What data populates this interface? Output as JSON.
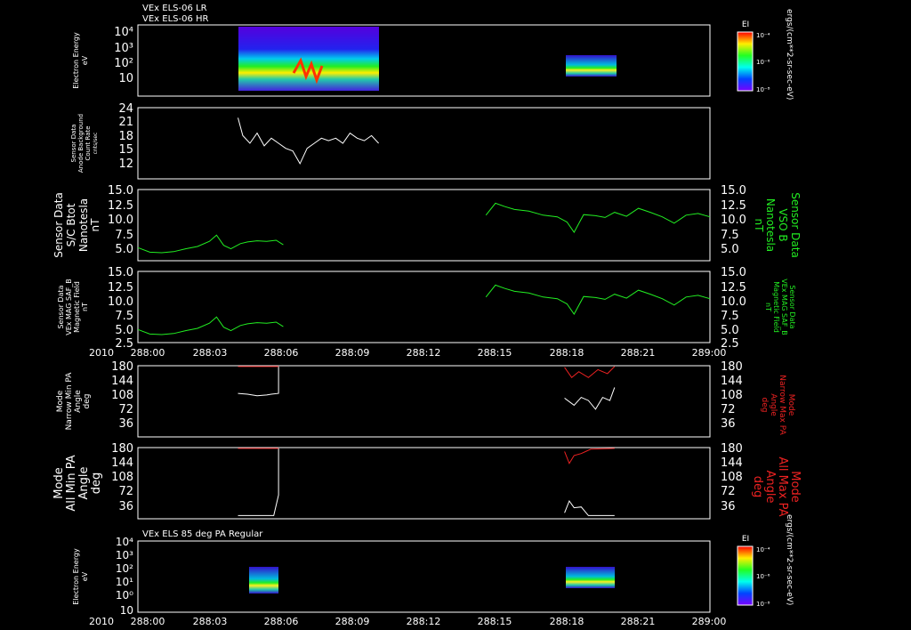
{
  "colors": {
    "background": "#000000",
    "axis": "#ffffff",
    "green": "#22ee22",
    "red": "#ee2222",
    "white": "#ffffff"
  },
  "header": {
    "line1": "VEx ELS-06 LR",
    "line2": "VEx ELS-06 HR",
    "bottom_title": "VEx ELS 85 deg PA Regular"
  },
  "colorbar": {
    "label": "EI",
    "tick_hi": "10⁻⁴",
    "tick_mid": "10⁻⁶",
    "tick_lo": "10⁻⁸",
    "unit": "ergs/(cm**2-sr-sec-eV)"
  },
  "xaxis": {
    "year": "2010",
    "ticks": [
      "288:00",
      "288:03",
      "288:06",
      "288:09",
      "288:12",
      "288:15",
      "288:18",
      "288:21",
      "289:00"
    ]
  },
  "panels": {
    "p1": {
      "ylabel": [
        "Electron Energy",
        "eV"
      ],
      "ticks": [
        "10⁴",
        "10³",
        "10²",
        "10"
      ]
    },
    "p2": {
      "ylabel": [
        "Sensor Data",
        "Anode Background",
        "Count Rate",
        "cnts/sec"
      ],
      "ticks": [
        "24",
        "21",
        "18",
        "15",
        "12"
      ]
    },
    "p3": {
      "ylabel": [
        "Sensor Data",
        "S/C Btot",
        "Nanotesla",
        "nT"
      ],
      "ylabel_right": [
        "Sensor Data",
        "VSO B",
        "Nanotesla",
        "nT"
      ],
      "ticks": [
        "15.0",
        "12.5",
        "10.0",
        "7.5",
        "5.0"
      ]
    },
    "p4": {
      "ylabel": [
        "Sensor Data",
        "VEx MAG SAF_B",
        "Magnetic Field",
        "nT"
      ],
      "ylabel_right": [
        "Sensor Data",
        "VEx MAG SAF_B",
        "Magnetic Field",
        "nT"
      ],
      "ticks": [
        "15.0",
        "12.5",
        "10.0",
        "7.5",
        "5.0",
        "2.5"
      ]
    },
    "p5": {
      "ylabel": [
        "Mode",
        "Narrow Min PA",
        "Angle",
        "deg"
      ],
      "ylabel_right": [
        "Mode",
        "Narrow Max PA",
        "Angle",
        "deg"
      ],
      "ticks": [
        "180",
        "144",
        "108",
        "72",
        "36"
      ]
    },
    "p6": {
      "ylabel": [
        "Mode",
        "All Min PA",
        "Angle",
        "deg"
      ],
      "ylabel_right": [
        "Mode",
        "All Max PA",
        "Angle",
        "deg"
      ],
      "ticks": [
        "180",
        "144",
        "108",
        "72",
        "36"
      ]
    },
    "p7": {
      "ylabel": [
        "Electron Energy",
        "eV"
      ],
      "ticks": [
        "10⁴",
        "10³",
        "10²",
        "10¹",
        "10⁰",
        "10"
      ]
    }
  },
  "chart_data": [
    {
      "type": "heatmap",
      "title": "VEx ELS-06 LR / HR",
      "ylabel": "Electron Energy eV",
      "ylog": true,
      "ylim": [
        5,
        15000
      ],
      "xlim": [
        "288:00",
        "289:00"
      ],
      "blocks": [
        {
          "x_start": "288:04.1",
          "x_end": "288:10.4"
        },
        {
          "x_start": "288:17.9",
          "x_end": "288:20.0"
        }
      ]
    },
    {
      "type": "line",
      "ylabel": "Anode Background Count Rate cnts/sec",
      "ylim": [
        10,
        24
      ],
      "series": [
        {
          "x": [
            4.2,
            4.4,
            4.7,
            5.0,
            5.3,
            5.6,
            5.9,
            6.2,
            6.5,
            6.8,
            7.1,
            7.4,
            7.7,
            8.0,
            8.3,
            8.6,
            8.9,
            9.2,
            9.5,
            9.8,
            10.1
          ],
          "values": [
            22,
            18.5,
            17,
            19,
            16.5,
            18,
            17,
            16,
            15.5,
            13,
            16,
            17,
            18,
            17.5,
            18,
            17,
            19,
            18,
            17.5,
            18.5,
            17
          ]
        }
      ]
    },
    {
      "type": "line",
      "ylabel": "S/C Btot nT",
      "ylim": [
        2.5,
        15
      ],
      "series": [
        {
          "name": "S/C Btot",
          "x": [
            0,
            0.5,
            1,
            1.5,
            2,
            2.5,
            3,
            3.3,
            3.6,
            3.9,
            4.3,
            4.6,
            5,
            5.4,
            5.8,
            6.1
          ],
          "values": [
            4.8,
            4.0,
            3.9,
            4.1,
            4.6,
            5.0,
            5.9,
            7.0,
            5.2,
            4.6,
            5.5,
            5.8,
            6.0,
            5.9,
            6.1,
            5.3
          ]
        },
        {
          "name": "VSO B",
          "x": [
            14.6,
            15,
            15.4,
            15.8,
            16.4,
            17,
            17.6,
            18.0,
            18.3,
            18.7,
            19.2,
            19.6,
            20,
            20.5,
            21,
            21.5,
            22,
            22.5,
            23,
            23.5,
            24
          ],
          "values": [
            10.5,
            12.6,
            12.0,
            11.5,
            11.2,
            10.5,
            10.2,
            9.3,
            7.5,
            10.6,
            10.4,
            10.1,
            11.0,
            10.3,
            11.7,
            11.0,
            10.2,
            9.1,
            10.5,
            10.8,
            10.2
          ]
        }
      ]
    },
    {
      "type": "line",
      "ylabel": "VEx MAG SAF_B Magnetic Field nT",
      "ylim": [
        2.5,
        15
      ],
      "series": [
        {
          "x": [
            0,
            0.5,
            1,
            1.5,
            2,
            2.5,
            3,
            3.3,
            3.6,
            3.9,
            4.3,
            4.6,
            5,
            5.4,
            5.8,
            6.1
          ],
          "values": [
            4.8,
            4.0,
            3.9,
            4.1,
            4.6,
            5.0,
            5.9,
            7.0,
            5.2,
            4.6,
            5.5,
            5.8,
            6.0,
            5.9,
            6.1,
            5.3
          ]
        },
        {
          "x": [
            14.6,
            15,
            15.4,
            15.8,
            16.4,
            17,
            17.6,
            18.0,
            18.3,
            18.7,
            19.2,
            19.6,
            20,
            20.5,
            21,
            21.5,
            22,
            22.5,
            23,
            23.5,
            24
          ],
          "values": [
            10.5,
            12.6,
            12.0,
            11.5,
            11.2,
            10.5,
            10.2,
            9.3,
            7.5,
            10.6,
            10.4,
            10.1,
            11.0,
            10.3,
            11.7,
            11.0,
            10.2,
            9.1,
            10.5,
            10.8,
            10.2
          ]
        }
      ]
    },
    {
      "type": "line",
      "ylabel": "Narrow Min/Max PA Angle deg",
      "ylim": [
        0,
        180
      ],
      "series": [
        {
          "x": [
            4.2,
            4.6,
            5.0,
            5.4,
            5.6,
            5.9,
            5.9
          ],
          "values": [
            110,
            108,
            104,
            106,
            108,
            110,
            178
          ]
        },
        {
          "x": [
            4.2,
            5.9
          ],
          "values": [
            178,
            178
          ]
        },
        {
          "x": [
            17.9,
            18.3,
            18.6,
            18.9,
            19.2,
            19.5,
            19.8,
            20.0
          ],
          "values": [
            98,
            80,
            100,
            92,
            70,
            100,
            92,
            125
          ]
        },
        {
          "x": [
            17.9,
            18.2,
            18.5,
            18.9,
            19.3,
            19.7,
            20.0
          ],
          "values": [
            176,
            150,
            165,
            150,
            170,
            160,
            178
          ]
        }
      ]
    },
    {
      "type": "line",
      "ylabel": "All Min/Max PA Angle deg",
      "ylim": [
        0,
        180
      ],
      "series": [
        {
          "x": [
            4.2,
            5.7,
            5.9,
            5.9
          ],
          "values": [
            8,
            8,
            60,
            178
          ]
        },
        {
          "x": [
            4.2,
            5.9
          ],
          "values": [
            178,
            178
          ]
        },
        {
          "x": [
            17.9,
            18.1,
            18.3,
            18.6,
            18.9,
            20.0
          ],
          "values": [
            15,
            45,
            28,
            30,
            8,
            8
          ]
        },
        {
          "x": [
            17.9,
            18.1,
            18.3,
            18.6,
            19.0,
            20.0
          ],
          "values": [
            170,
            140,
            160,
            165,
            176,
            178
          ]
        }
      ]
    },
    {
      "type": "heatmap",
      "title": "VEx ELS 85 deg PA Regular",
      "ylabel": "Electron Energy eV",
      "ylog": true,
      "ylim": [
        1,
        15000
      ],
      "xlim": [
        "288:00",
        "289:00"
      ],
      "blocks": [
        {
          "x_start": "288:04.8",
          "x_end": "288:05.9"
        },
        {
          "x_start": "288:17.9",
          "x_end": "288:20.0"
        }
      ]
    }
  ]
}
